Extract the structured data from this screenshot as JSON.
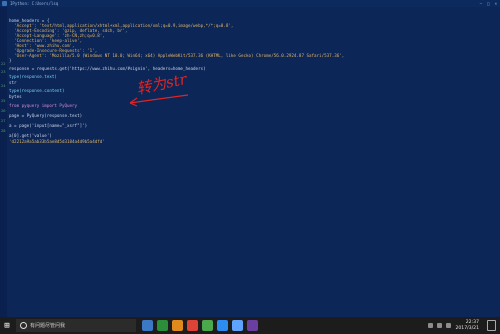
{
  "window": {
    "title": "IPython: C:Users/lsq"
  },
  "editor": {
    "lines": [
      {
        "num": "",
        "code": "home_headers = {"
      },
      {
        "num": "",
        "code": "  'Accept': 'text/html,application/xhtml+xml,application/xml;q=0.9,image/webp,*/*;q=0.8',"
      },
      {
        "num": "",
        "code": "  'Accept-Encoding': 'gzip, deflate, sdch, br',"
      },
      {
        "num": "",
        "code": "  'Accept-Language': 'zh-CN,zh;q=0.8',"
      },
      {
        "num": "",
        "code": "  'Connection': 'keep-alive',"
      },
      {
        "num": "",
        "code": "  'Host': 'www.zhihu.com',"
      },
      {
        "num": "",
        "code": "  'Upgrade-Insecure-Requests': '1',"
      },
      {
        "num": "",
        "code": "  'User-Agent': 'Mozilla/5.0 (Windows NT 10.0; Win64; x64) AppleWebKit/537.36 (KHTML, like Gecko) Chrome/56.0.2924.87 Safari/537.36',"
      },
      {
        "num": "",
        "code": "}"
      },
      {
        "num": "22",
        "code": "response = requests.get('https://www.zhihu.com/#signin', headers=home_headers)"
      },
      {
        "num": "23",
        "code": "type(response.text)"
      },
      {
        "num": "",
        "code": "str"
      },
      {
        "num": "24",
        "code": "type(response.content)"
      },
      {
        "num": "",
        "code": "bytes"
      },
      {
        "num": "25",
        "code": "from pyquery import PyQuery"
      },
      {
        "num": "26",
        "code": "page = PyQuery(response.text)"
      },
      {
        "num": "27",
        "code": "a = page('input[name=\"_xsrf\"]')"
      },
      {
        "num": "28",
        "code": "a[0].get('value')"
      },
      {
        "num": "",
        "code": "'d2212a9a5ab33b5ae8d5d3184a4d9b5a4dfd'"
      }
    ]
  },
  "annotation": {
    "text": "转为str"
  },
  "taskbar": {
    "search_placeholder": "有问题尽管问我",
    "time": "22:37",
    "date": "2017/3/21",
    "task_icon_colors": [
      "#3b78c6",
      "#2a8e3a",
      "#e08a1e",
      "#db4437",
      "#4aa94a",
      "#2d8cf0",
      "#5ea4ff",
      "#6b3fa0"
    ]
  }
}
